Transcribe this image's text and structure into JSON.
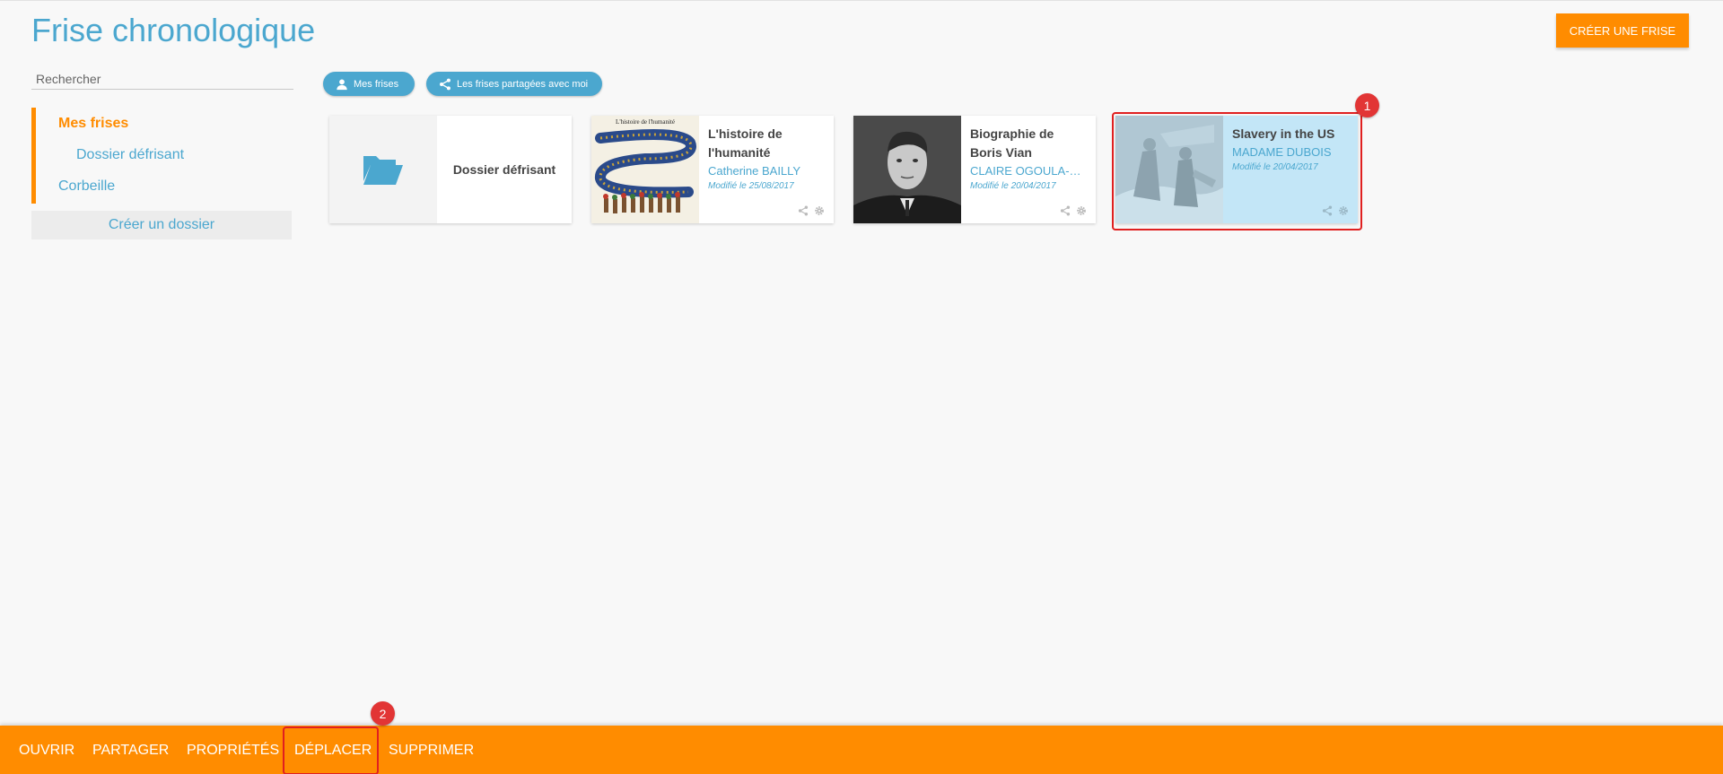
{
  "header": {
    "title": "Frise chronologique",
    "create_frise_label": "CRÉER UNE FRISE"
  },
  "sidebar": {
    "search_placeholder": "Rechercher",
    "tree": [
      {
        "label": "Mes frises",
        "active": true
      },
      {
        "label": "Dossier défrisant",
        "active": false
      },
      {
        "label": "Corbeille",
        "active": false
      }
    ],
    "create_folder_label": "Créer un dossier"
  },
  "filters": [
    {
      "label": "Mes frises",
      "icon": "user-icon"
    },
    {
      "label": "Les frises partagées avec moi",
      "icon": "share-icon"
    }
  ],
  "cards": {
    "folder": {
      "label": "Dossier défrisant",
      "icon": "folder-open-icon"
    },
    "frises": [
      {
        "title": "L'histoire de l'humanité",
        "owner": "Catherine BAILLY",
        "date": "Modifié le 25/08/2017",
        "thumb_caption": "L'histoire de l'humanité"
      },
      {
        "title": "Biographie de Boris Vian",
        "owner": "CLAIRE OGOULA-NGOUONI",
        "date": "Modifié le 20/04/2017"
      },
      {
        "title": "Slavery in the US",
        "owner": "MADAME DUBOIS",
        "date": "Modifié le 20/04/2017",
        "selected": true
      }
    ]
  },
  "annotations": {
    "card_badge": "1",
    "action_badge": "2"
  },
  "action_bar": {
    "actions": [
      "OUVRIR",
      "PARTAGER",
      "PROPRIÉTÉS",
      "DÉPLACER",
      "SUPPRIMER"
    ]
  },
  "colors": {
    "accent": "#ff8c00",
    "primary": "#4ba7cf",
    "selected": "#c3e6f7",
    "annotation": "#e23535"
  }
}
